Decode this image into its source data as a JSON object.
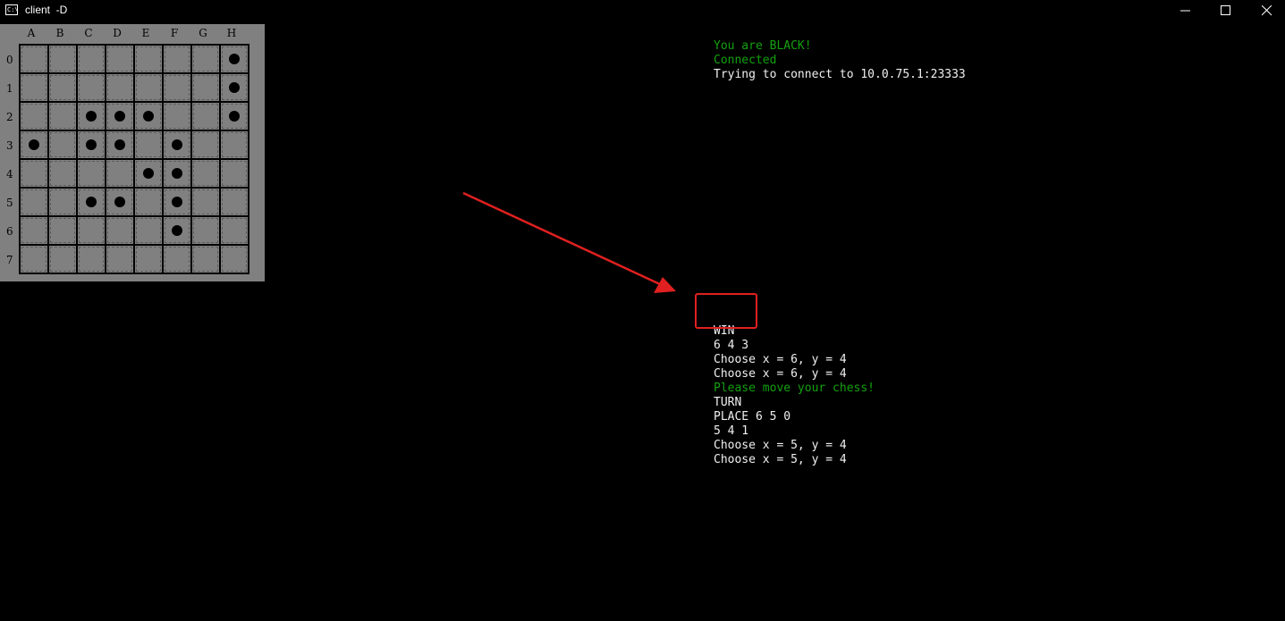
{
  "window": {
    "title": "client  -D",
    "icon": "console-app-icon",
    "icon_text": "C:\\",
    "controls": [
      "minimize",
      "maximize",
      "close"
    ]
  },
  "board": {
    "columns": [
      "A",
      "B",
      "C",
      "D",
      "E",
      "F",
      "G",
      "H"
    ],
    "rows": [
      "0",
      "1",
      "2",
      "3",
      "4",
      "5",
      "6",
      "7"
    ],
    "pieces": [
      {
        "row": 0,
        "col": 7,
        "color": "black"
      },
      {
        "row": 1,
        "col": 7,
        "color": "black"
      },
      {
        "row": 2,
        "col": 2,
        "color": "black"
      },
      {
        "row": 2,
        "col": 3,
        "color": "black"
      },
      {
        "row": 2,
        "col": 4,
        "color": "black"
      },
      {
        "row": 2,
        "col": 7,
        "color": "black"
      },
      {
        "row": 3,
        "col": 0,
        "color": "black"
      },
      {
        "row": 3,
        "col": 2,
        "color": "black"
      },
      {
        "row": 3,
        "col": 3,
        "color": "black"
      },
      {
        "row": 3,
        "col": 5,
        "color": "black"
      },
      {
        "row": 4,
        "col": 4,
        "color": "black"
      },
      {
        "row": 4,
        "col": 5,
        "color": "black"
      },
      {
        "row": 5,
        "col": 2,
        "color": "black"
      },
      {
        "row": 5,
        "col": 3,
        "color": "black"
      },
      {
        "row": 5,
        "col": 5,
        "color": "black"
      },
      {
        "row": 6,
        "col": 5,
        "color": "black"
      }
    ]
  },
  "console": {
    "top_lines": [
      {
        "text": "You are BLACK!",
        "color": "green"
      },
      {
        "text": "Connected",
        "color": "green"
      },
      {
        "text": "Trying to connect to 10.0.75.1:23333",
        "color": "white"
      }
    ],
    "bottom_lines": [
      {
        "text": "",
        "color": "white"
      },
      {
        "text": "WIN",
        "color": "white"
      },
      {
        "text": "6 4 3",
        "color": "white"
      },
      {
        "text": "Choose x = 6, y = 4",
        "color": "white"
      },
      {
        "text": "Choose x = 6, y = 4",
        "color": "white"
      },
      {
        "text": "Please move your chess!",
        "color": "green"
      },
      {
        "text": "TURN",
        "color": "white"
      },
      {
        "text": "PLACE 6 5 0",
        "color": "white"
      },
      {
        "text": "5 4 1",
        "color": "white"
      },
      {
        "text": "Choose x = 5, y = 4",
        "color": "white"
      },
      {
        "text": "Choose x = 5, y = 4",
        "color": "white"
      }
    ]
  },
  "annotation": {
    "color": "#e02020",
    "arrow_icon": "red-arrow-icon",
    "highlight_target": "WIN"
  },
  "colors": {
    "background": "#000000",
    "board": "#808080",
    "console_green": "#13a10e",
    "console_white": "#f0f0f0"
  }
}
